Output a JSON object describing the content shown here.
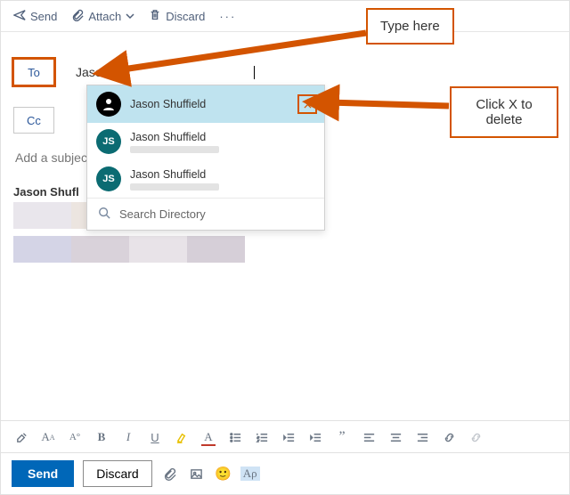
{
  "toolbar": {
    "send": "Send",
    "attach": "Attach",
    "discard": "Discard",
    "more": "···"
  },
  "fields": {
    "to_label": "To",
    "cc_label": "Cc",
    "to_value": "Jason",
    "subject_placeholder": "Add a subject"
  },
  "suggestions": {
    "items": [
      {
        "name": "Jason Shuffield",
        "initials": "",
        "selected": true,
        "avatar": "icon"
      },
      {
        "name": "Jason Shuffield",
        "initials": "JS",
        "selected": false,
        "avatar": "circle"
      },
      {
        "name": "Jason Shuffield",
        "initials": "JS",
        "selected": false,
        "avatar": "circle"
      }
    ],
    "search_directory": "Search Directory"
  },
  "body": {
    "visible_text": "Jason Shufl"
  },
  "format": {
    "bold": "B",
    "italic": "I",
    "underline": "U",
    "font_color": "A",
    "highlight_sample": "Aρ"
  },
  "actions": {
    "send": "Send",
    "discard": "Discard"
  },
  "callouts": {
    "type_here": "Type here",
    "click_x": "Click X to delete"
  }
}
